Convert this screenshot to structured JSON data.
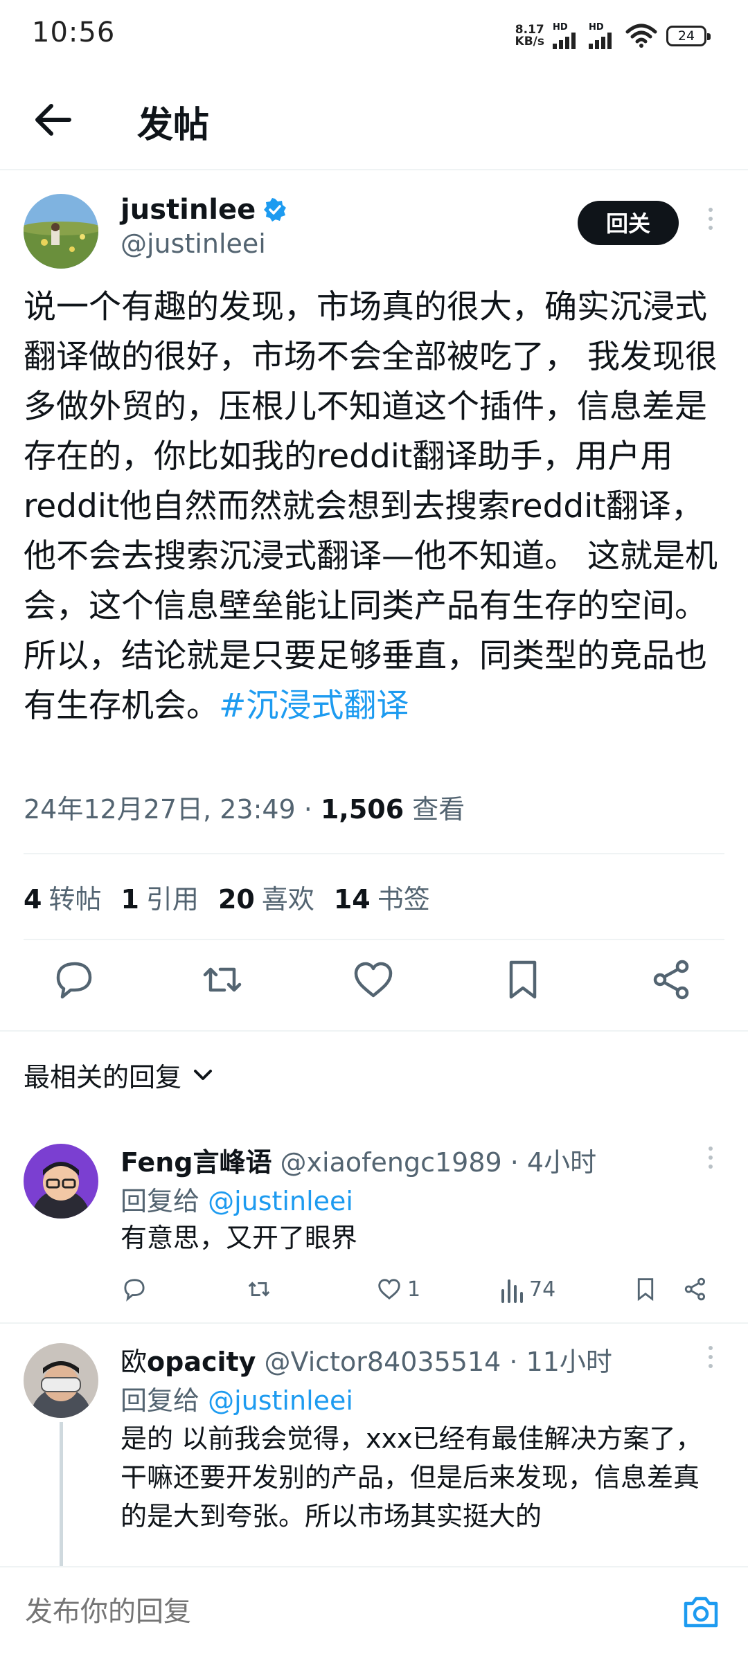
{
  "status_bar": {
    "time": "10:56",
    "net_speed_value": "8.17",
    "net_speed_unit": "KB/s",
    "hd_label": "HD",
    "battery": "24"
  },
  "header": {
    "title": "发帖"
  },
  "post": {
    "author_name": "justinlee",
    "author_handle": "@justinleei",
    "follow_label": "回关",
    "body": "说一个有趣的发现，市场真的很大，确实沉浸式翻译做的很好，市场不会全部被吃了， 我发现很多做外贸的，压根儿不知道这个插件，信息差是存在的，你比如我的reddit翻译助手，用户用reddit他自然而然就会想到去搜索reddit翻译，他不会去搜索沉浸式翻译—他不知道。 这就是机会，这个信息壁垒能让同类产品有生存的空间。所以，结论就是只要足够垂直，同类型的竞品也有生存机会。",
    "hashtag": "#沉浸式翻译",
    "timestamp": "24年12月27日, 23:49 · ",
    "views_count": "1,506",
    "views_label": " 查看",
    "stats": [
      {
        "count": "4",
        "label": "转帖"
      },
      {
        "count": "1",
        "label": "引用"
      },
      {
        "count": "20",
        "label": "喜欢"
      },
      {
        "count": "14",
        "label": "书签"
      }
    ]
  },
  "sort_label": "最相关的回复",
  "replies": [
    {
      "name": "Feng言峰语",
      "handle_time": " @xiaofengc1989 · 4小时",
      "reply_to_label": "回复给 ",
      "reply_to_handle": "@justinleei",
      "text": "有意思，又开了眼界",
      "likes": "1",
      "views": "74"
    },
    {
      "name_prefix": "欧",
      "name": "opacity",
      "handle_time": " @Victor84035514 · 11小时",
      "reply_to_label": "回复给 ",
      "reply_to_handle": "@justinleei",
      "text": "是的 以前我会觉得，xxx已经有最佳解决方案了，干嘛还要开发别的产品，但是后来发现，信息差真的是大到夸张。所以市场其实挺大的"
    }
  ],
  "compose": {
    "placeholder": "发布你的回复"
  },
  "colors": {
    "accent": "#1d9bf0",
    "text": "#0f1419",
    "secondary": "#536471"
  }
}
